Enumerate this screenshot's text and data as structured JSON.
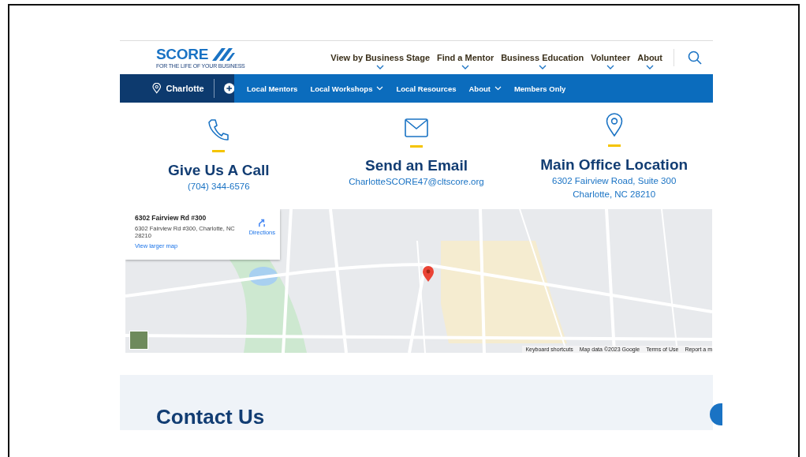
{
  "logo": {
    "wordmark": "SCORE",
    "tagline": "FOR THE LIFE OF YOUR BUSINESS"
  },
  "main_nav": [
    {
      "label": "View by Business Stage",
      "has_menu": true
    },
    {
      "label": "Find a Mentor",
      "has_menu": true
    },
    {
      "label": "Business Education",
      "has_menu": true
    },
    {
      "label": "Volunteer",
      "has_menu": true
    },
    {
      "label": "About",
      "has_menu": true
    }
  ],
  "chapter_bar": {
    "chapter": "Charlotte",
    "links": [
      {
        "label": "Local Mentors",
        "has_menu": false
      },
      {
        "label": "Local Workshops",
        "has_menu": true
      },
      {
        "label": "Local Resources",
        "has_menu": false
      },
      {
        "label": "About",
        "has_menu": true
      },
      {
        "label": "Members Only",
        "has_menu": false
      }
    ]
  },
  "contact_cards": [
    {
      "kind": "phone",
      "title": "Give Us A Call",
      "lines": [
        "(704) 344-6576"
      ]
    },
    {
      "kind": "email",
      "title": "Send an Email",
      "lines": [
        "CharlotteSCORE47@cltscore.org"
      ]
    },
    {
      "kind": "location",
      "title": "Main Office Location",
      "lines": [
        "6302 Fairview Road, Suite 300",
        "Charlotte, NC 28210"
      ]
    }
  ],
  "map": {
    "place_name": "6302 Fairview Rd #300",
    "address": "6302 Fairview Rd #300, Charlotte, NC 28210",
    "directions": "Directions",
    "larger_map_link": "View larger map",
    "footer_links": [
      "Keyboard shortcuts",
      "Map data ©2023 Google",
      "Terms of Use",
      "Report a m"
    ]
  },
  "contact_section": {
    "heading": "Contact Us"
  }
}
